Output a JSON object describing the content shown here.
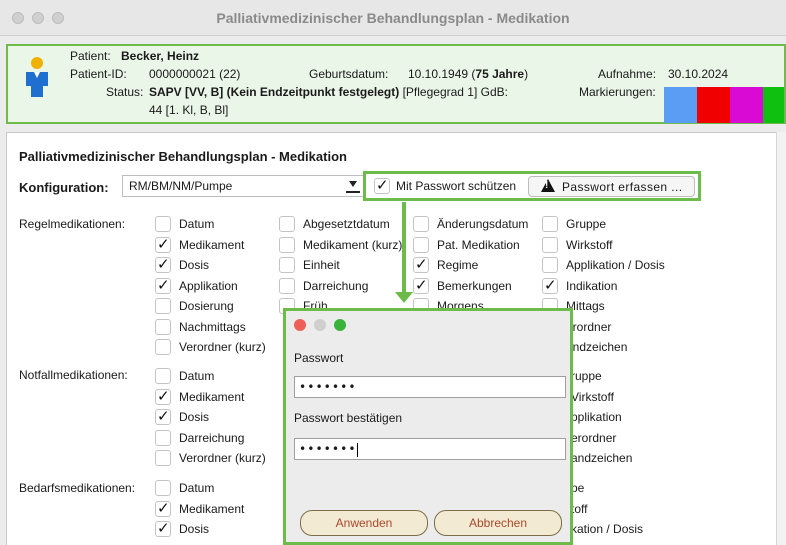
{
  "window": {
    "title": "Palliativmedizinischer Behandlungsplan - Medikation"
  },
  "patient": {
    "patient_label": "Patient:",
    "patient_name": "Becker, Heinz",
    "id_label": "Patient-ID:",
    "id_value": "0000000021 (22)",
    "dob_label": "Geburtsdatum:",
    "dob_value": "10.10.1949 (",
    "age": "75 Jahre",
    "dob_close": ")",
    "admission_label": "Aufnahme:",
    "admission_value": "30.10.2024",
    "status_label": "Status:",
    "status_bold": "SAPV [VV, B] (Kein Endzeitpunkt festgelegt)",
    "status_rest": " [Pflegegrad 1] GdB:",
    "status_line2": "44 [1. Kl, B, Bl]",
    "markers_label": "Markierungen:",
    "marker_colors": [
      "#5b9cf4",
      "#f00000",
      "#d90ad4",
      "#10c010"
    ]
  },
  "main": {
    "heading": "Palliativmedizinischer Behandlungsplan - Medikation",
    "config_label": "Konfiguration:",
    "config_value": "RM/BM/NM/Pumpe",
    "password_protect_label": "Mit Passwort schützen",
    "password_button_label": "Passwort erfassen ...",
    "regel_label": "Regelmedikationen:",
    "notfall_label": "Notfallmedikationen:",
    "bedarf_label": "Bedarfsmedikationen:",
    "regel_col1": [
      {
        "label": "Datum",
        "checked": false
      },
      {
        "label": "Medikament",
        "checked": true
      },
      {
        "label": "Dosis",
        "checked": true
      },
      {
        "label": "Applikation",
        "checked": true
      },
      {
        "label": "Dosierung",
        "checked": false
      },
      {
        "label": "Nachmittags",
        "checked": false
      },
      {
        "label": "Verordner (kurz)",
        "checked": false
      }
    ],
    "regel_col2": [
      {
        "label": "Abgesetztdatum",
        "checked": false
      },
      {
        "label": "Medikament (kurz)",
        "checked": false
      },
      {
        "label": "Einheit",
        "checked": false
      },
      {
        "label": "Darreichung",
        "checked": false
      },
      {
        "label": "Früh",
        "checked": false
      }
    ],
    "regel_col3": [
      {
        "label": "Änderungsdatum",
        "checked": false
      },
      {
        "label": "Pat. Medikation",
        "checked": false
      },
      {
        "label": "Regime",
        "checked": true
      },
      {
        "label": "Bemerkungen",
        "checked": true
      },
      {
        "label": "Morgens",
        "checked": false
      }
    ],
    "regel_col4": [
      {
        "label": "Gruppe",
        "checked": false
      },
      {
        "label": "Wirkstoff",
        "checked": false
      },
      {
        "label": "Applikation / Dosis",
        "checked": false
      },
      {
        "label": "Indikation",
        "checked": true
      },
      {
        "label": "Mittags",
        "checked": false
      },
      {
        "label": "erordner",
        "checked": false
      },
      {
        "label": "andzeichen",
        "checked": false
      }
    ],
    "notfall_col1": [
      {
        "label": "Datum",
        "checked": false
      },
      {
        "label": "Medikament",
        "checked": true
      },
      {
        "label": "Dosis",
        "checked": true
      },
      {
        "label": "Darreichung",
        "checked": false
      },
      {
        "label": "Verordner (kurz)",
        "checked": false
      }
    ],
    "notfall_col4": [
      "ruppe",
      "Virkstoff",
      "pplikation",
      "erordner",
      "andzeichen"
    ],
    "bedarf_col1": [
      {
        "label": "Datum",
        "checked": false
      },
      {
        "label": "Medikament",
        "checked": true
      },
      {
        "label": "Dosis",
        "checked": true
      }
    ],
    "bedarf_col4": [
      "pe",
      "toff",
      "kation / Dosis"
    ]
  },
  "dialog": {
    "password_label": "Passwort",
    "password_value": "•••••••",
    "confirm_label": "Passwort bestätigen",
    "confirm_value": "•••••••",
    "apply_label": "Anwenden",
    "cancel_label": "Abbrechen"
  }
}
